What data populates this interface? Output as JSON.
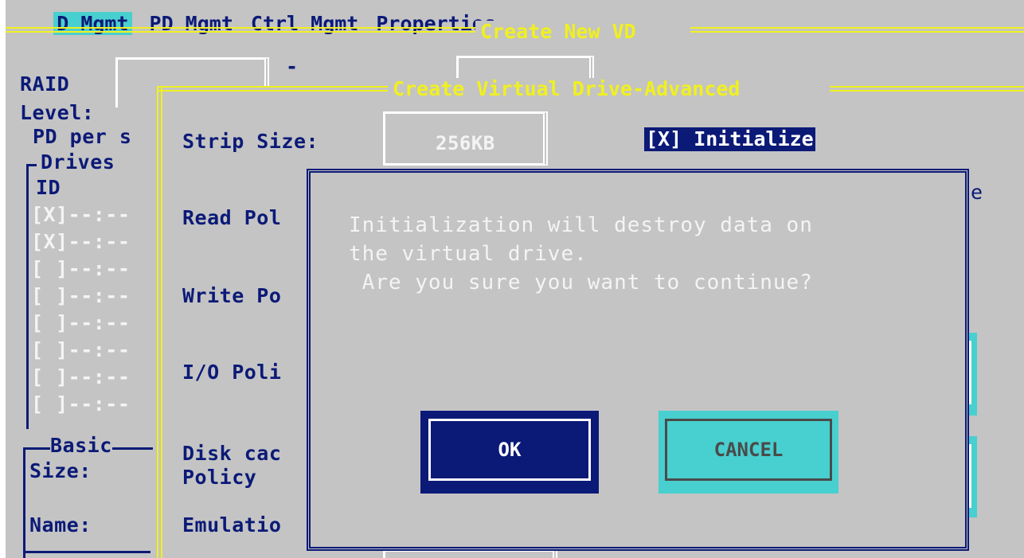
{
  "menu": {
    "active": "D Mgmt",
    "items": [
      "PD Mgmt",
      "Ctrl Mgmt",
      "Properties"
    ]
  },
  "outer_window": {
    "title": "Create New VD"
  },
  "left_panel": {
    "raid_label": "RAID",
    "level_label": "Level:",
    "pd_per_span_label": "PD per s",
    "drives_group_label": "Drives",
    "id_header": "ID",
    "drive_rows": [
      "[X]--:--",
      "[X]--:--",
      "[ ]--:--",
      "[ ]--:--",
      "[ ]--:--",
      "[ ]--:--",
      "[ ]--:--",
      "[ ]--:--"
    ],
    "basic_group_label": "Basic",
    "size_label": "Size:",
    "name_label": "Name:"
  },
  "advanced_window": {
    "title": "Create Virtual Drive-Advanced",
    "strip_size_label": "Strip Size:",
    "strip_size_value": "256KB",
    "initialize_label": "[X] Initialize",
    "read_policy_label": "Read Pol",
    "write_policy_label": "Write Po",
    "io_policy_label": "I/O Poli",
    "disk_cache_label_1": "Disk cac",
    "disk_cache_label_2": "Policy",
    "emulation_label": "Emulatio",
    "right_edge_char": "e"
  },
  "dialog": {
    "line1": "Initialization will destroy data on",
    "line2": "the virtual drive.",
    "line3": " Are you sure you want to continue?",
    "ok_label": "OK",
    "cancel_label": "CANCEL"
  },
  "colors": {
    "background": "#c4c4c4",
    "navy": "#0b1a77",
    "yellow": "#f0f020",
    "cyan": "#48cfcf",
    "white": "#ffffff"
  }
}
